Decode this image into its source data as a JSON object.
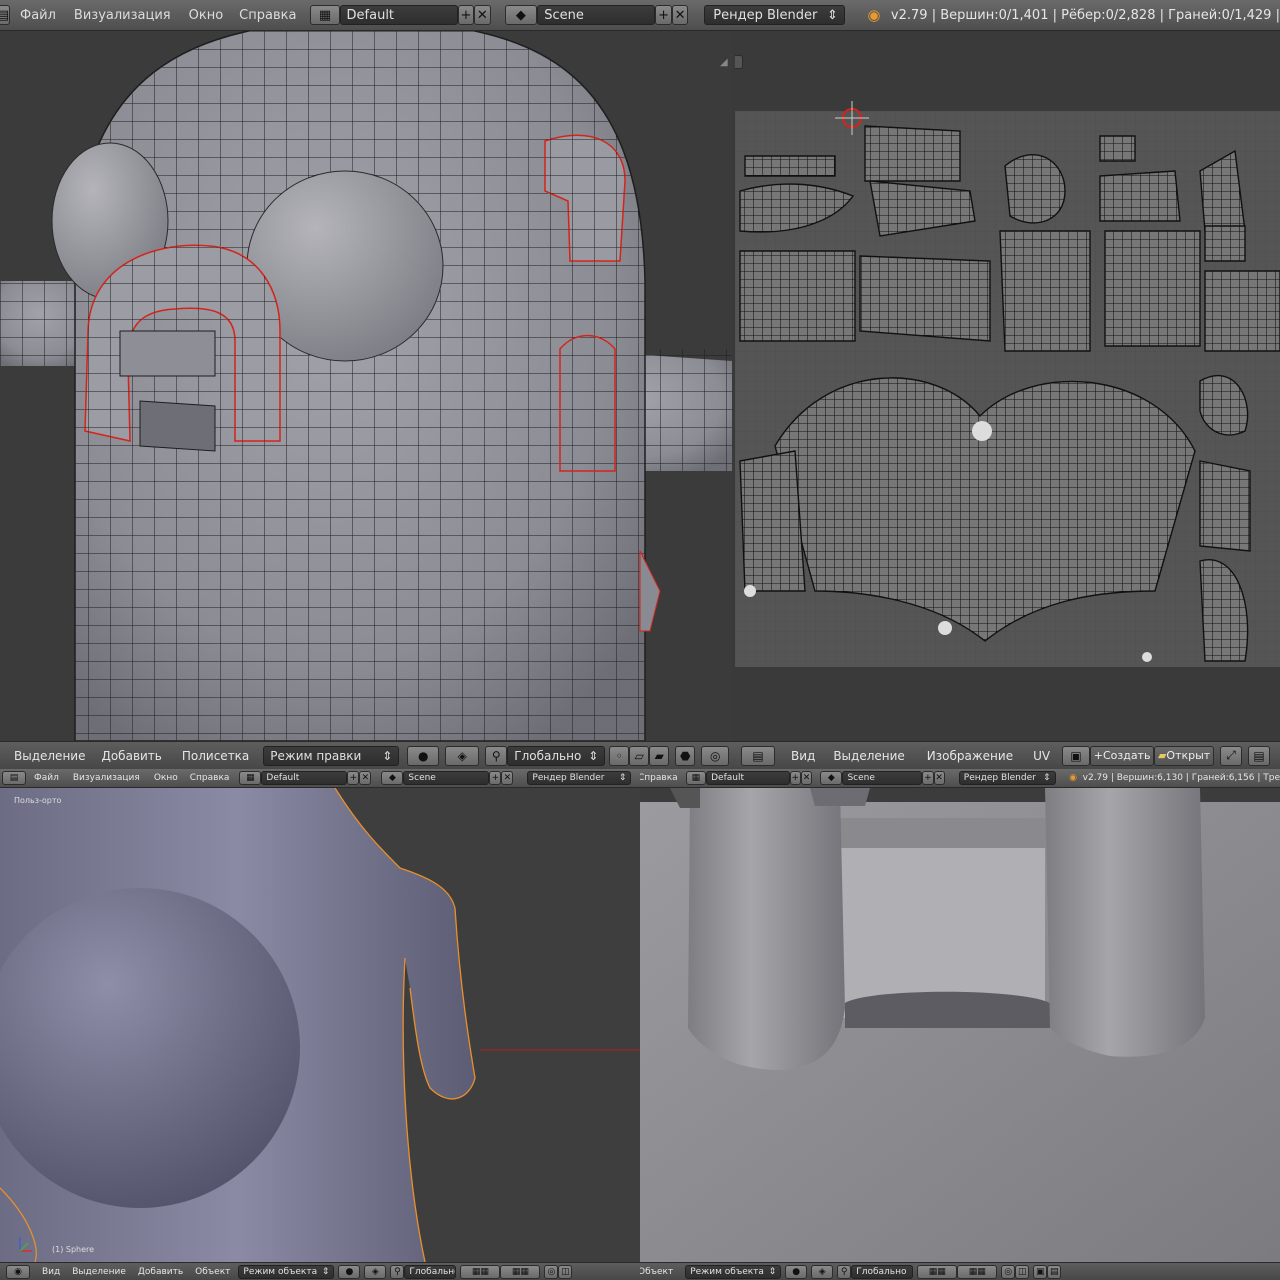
{
  "top": {
    "menus": [
      "Файл",
      "Визуализация",
      "Окно",
      "Справка"
    ],
    "layout": "Default",
    "scene": "Scene",
    "engine": "Рендер Blender",
    "stats": "v2.79 | Вершин:0/1,401 | Рёбер:0/2,828 | Граней:0/1,429 |"
  },
  "viewport_bar": {
    "items": [
      "Выделение",
      "Добавить",
      "Полисетка"
    ],
    "mode": "Режим правки",
    "orientation": "Глобально"
  },
  "uv_bar": {
    "items": [
      "Вид",
      "Выделение",
      "Изображение",
      "UV"
    ],
    "new_button": "Создать",
    "open_button": "Открыт"
  },
  "lower_top_left": {
    "menus": [
      "Файл",
      "Визуализация",
      "Окно",
      "Справка"
    ],
    "layout": "Default",
    "scene": "Scene",
    "engine": "Рендер Blender"
  },
  "lower_top_right": {
    "menus": [
      "Справка"
    ],
    "layout": "Default",
    "scene": "Scene",
    "engine": "Рендер Blender",
    "stats": "v2.79 | Вершин:6,130 | Граней:6,156 | Тре"
  },
  "bl_view": {
    "label": "Польз-орто",
    "object": "(1) Sphere"
  },
  "bl_bar": {
    "items": [
      "Вид",
      "Выделение",
      "Добавить",
      "Объект"
    ],
    "mode": "Режим объекта",
    "orientation": "Глобально"
  },
  "br_bar": {
    "items": [
      "Объект"
    ],
    "mode": "Режим объекта",
    "orientation": "Глобально"
  },
  "colors": {
    "accent_orange": "#e89a2c",
    "seam_red": "#d4241c",
    "select_orange": "#e8902a"
  }
}
